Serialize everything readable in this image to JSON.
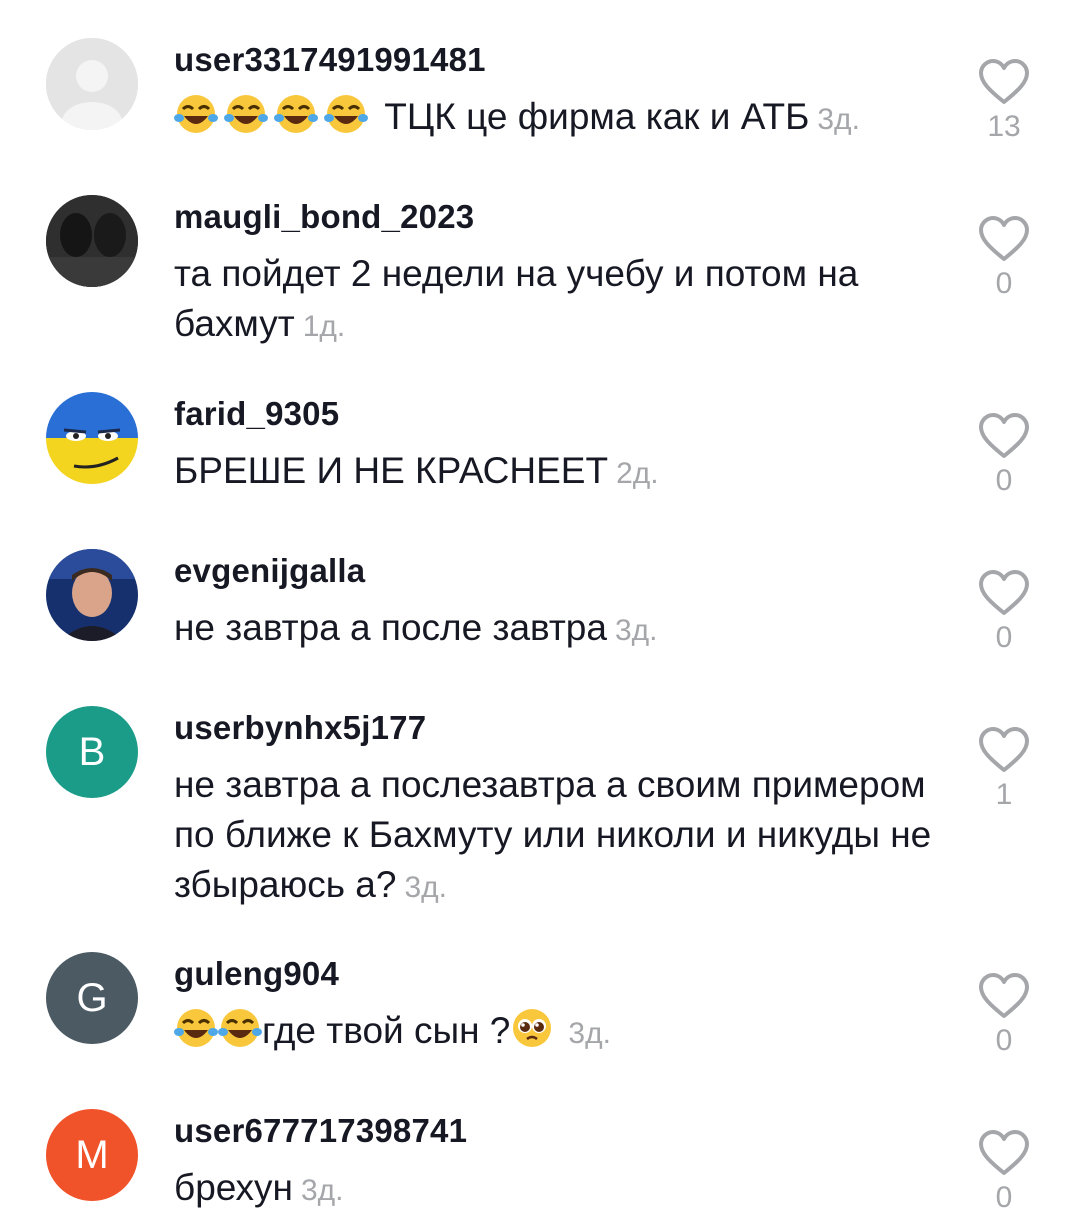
{
  "comments": [
    {
      "username": "user3317491991481",
      "text": "ТЦК це фирма как и АТБ",
      "time": "3д.",
      "likes": "13"
    },
    {
      "username": "maugli_bond_2023",
      "text": "та пойдет 2 недели на учебу и потом на бахмут",
      "time": "1д.",
      "likes": "0"
    },
    {
      "username": "farid_9305",
      "text": "БРЕШЕ И НЕ КРАСНЕЕТ",
      "time": "2д.",
      "likes": "0"
    },
    {
      "username": "evgenijgalla",
      "text": "не завтра а после завтра",
      "time": "3д.",
      "likes": "0"
    },
    {
      "username": "userbynhx5j177",
      "avatar_letter": "B",
      "avatar_color": "#1a9c88",
      "text": "не завтра а послезавтра а своим примером по ближе к Бахмуту или николи и никуды не збыраюсь а?",
      "time": "3д.",
      "likes": "1"
    },
    {
      "username": "guleng904",
      "avatar_letter": "G",
      "avatar_color": "#4b5a63",
      "text": "где твой сын ?",
      "time": "3д.",
      "likes": "0"
    },
    {
      "username": "user677717398741",
      "avatar_letter": "M",
      "avatar_color": "#f0522a",
      "text": "брехун",
      "time": "3д.",
      "likes": "0"
    }
  ],
  "icons": {
    "like": "heart-outline-icon",
    "laugh": "face-with-tears-of-joy-emoji",
    "pleading": "pleading-face-emoji"
  },
  "colors": {
    "text": "#161823",
    "secondary": "#a5a6aa"
  }
}
